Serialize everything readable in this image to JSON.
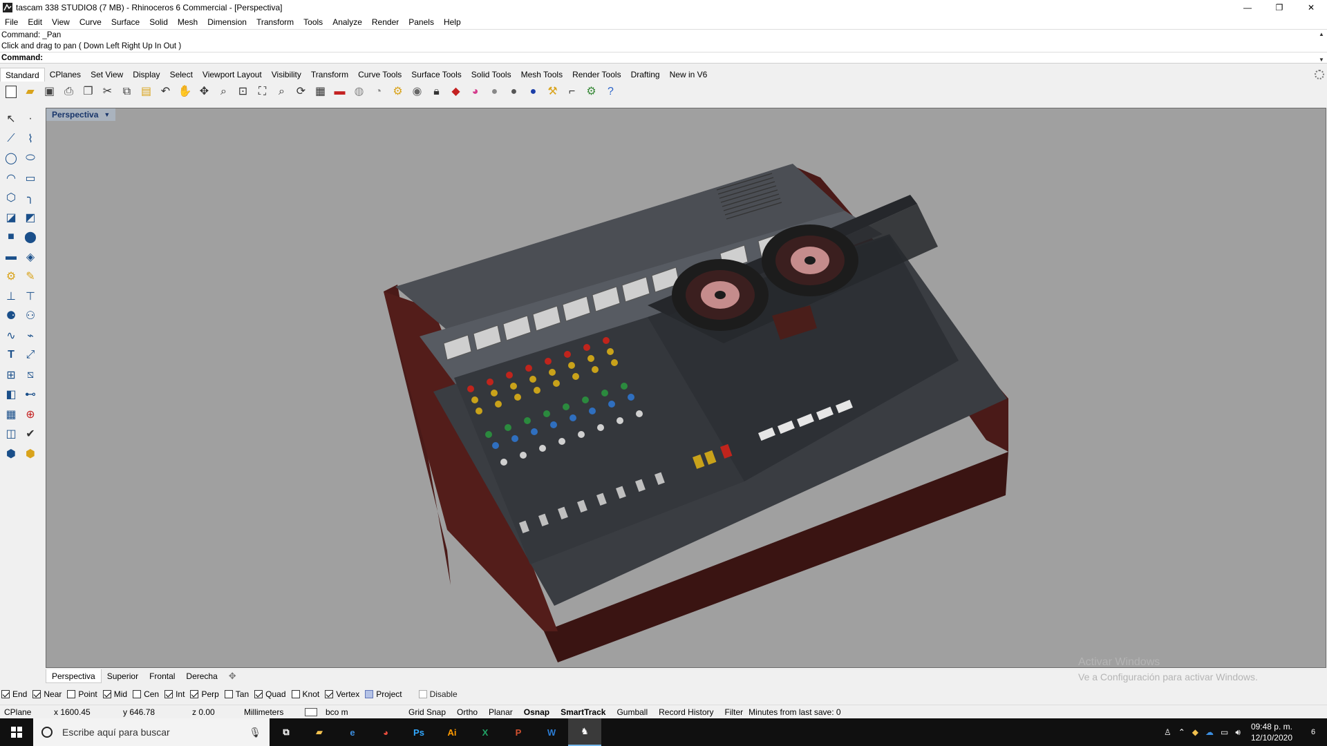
{
  "window": {
    "title": "tascam 338 STUDIO8 (7 MB) - Rhinoceros 6 Commercial - [Perspectiva]",
    "minimize": "—",
    "restore": "❐",
    "close": "✕"
  },
  "menu": [
    "File",
    "Edit",
    "View",
    "Curve",
    "Surface",
    "Solid",
    "Mesh",
    "Dimension",
    "Transform",
    "Tools",
    "Analyze",
    "Render",
    "Panels",
    "Help"
  ],
  "command": {
    "history1": "Command: _Pan",
    "history2": "Click and drag to pan ( Down  Left  Right  Up  In  Out )",
    "prompt": "Command:"
  },
  "toolbar_tabs": [
    "Standard",
    "CPlanes",
    "Set View",
    "Display",
    "Select",
    "Viewport Layout",
    "Visibility",
    "Transform",
    "Curve Tools",
    "Surface Tools",
    "Solid Tools",
    "Mesh Tools",
    "Render Tools",
    "Drafting",
    "New in V6"
  ],
  "toolbar_icons": [
    "new-file",
    "open",
    "save",
    "print",
    "import",
    "cut",
    "copy",
    "paste",
    "undo",
    "pan-hand",
    "move-view",
    "zoom",
    "zoom-window",
    "zoom-extents",
    "zoom-selected",
    "rotate-view",
    "four-viewports",
    "car",
    "lightbulb-off",
    "cplane",
    "osnap-shade",
    "light",
    "lock",
    "layer",
    "color-wheel",
    "material",
    "shaded",
    "rendered",
    "toolbox",
    "dimension",
    "gear",
    "help"
  ],
  "viewport": {
    "name": "Perspectiva",
    "watermark_title": "Activar Windows",
    "watermark_sub": "Ve a Configuración para activar Windows."
  },
  "viewport_tabs": [
    "Perspectiva",
    "Superior",
    "Frontal",
    "Derecha"
  ],
  "osnaps": [
    {
      "label": "End",
      "state": "on"
    },
    {
      "label": "Near",
      "state": "on"
    },
    {
      "label": "Point",
      "state": "off"
    },
    {
      "label": "Mid",
      "state": "on"
    },
    {
      "label": "Cen",
      "state": "off"
    },
    {
      "label": "Int",
      "state": "on"
    },
    {
      "label": "Perp",
      "state": "on"
    },
    {
      "label": "Tan",
      "state": "off"
    },
    {
      "label": "Quad",
      "state": "on"
    },
    {
      "label": "Knot",
      "state": "off"
    },
    {
      "label": "Vertex",
      "state": "on"
    },
    {
      "label": "Project",
      "state": "partial"
    },
    {
      "label": "Disable",
      "state": "disabled"
    }
  ],
  "status": {
    "cplane": "CPlane",
    "x": "x 1600.45",
    "y": "y 646.78",
    "z": "z 0.00",
    "units": "Millimeters",
    "layer": "bco m",
    "grid_snap": "Grid Snap",
    "ortho": "Ortho",
    "planar": "Planar",
    "osnap": "Osnap",
    "smarttrack": "SmartTrack",
    "gumball": "Gumball",
    "record_history": "Record History",
    "filter": "Filter",
    "minutes": "Minutes from last save: 0"
  },
  "taskbar": {
    "search_placeholder": "Escribe aquí para buscar",
    "apps": [
      "task-view",
      "file-explorer",
      "edge",
      "chrome",
      "photoshop",
      "illustrator",
      "excel",
      "powerpoint",
      "word",
      "rhino"
    ],
    "time": "09:48 p. m.",
    "date": "12/10/2020",
    "notifications": "6"
  },
  "colors": {
    "viewport_bg": "#a0a0a0",
    "console_panel": "#3a3d42",
    "wood_trim": "#4a1a18",
    "knob_yellow": "#c9a21a",
    "knob_red": "#c0241c",
    "knob_blue": "#2f6fbf",
    "knob_green": "#2b8a3e"
  }
}
